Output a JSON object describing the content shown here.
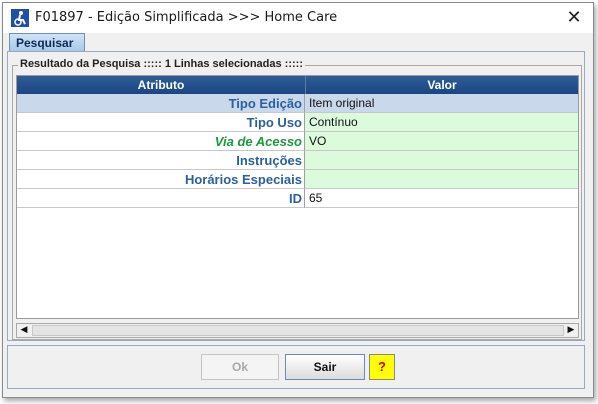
{
  "window": {
    "title": "F01897 - Edição Simplificada >>> Home Care",
    "close_glyph": "✕"
  },
  "tabs": [
    {
      "label": "Pesquisar"
    }
  ],
  "results": {
    "group_title": "Resultado da Pesquisa ::::: 1 Linhas selecionadas :::::",
    "columns": [
      "Atributo",
      "Valor"
    ],
    "rows": [
      {
        "attr": "Tipo Edição",
        "value": "Item original",
        "bg": "#c9d8ea"
      },
      {
        "attr": "Tipo Uso",
        "value": "Contínuo",
        "bg": "#dcfadc"
      },
      {
        "attr": "Via de Acesso",
        "value": "VO",
        "bg": "#dcfadc",
        "attr_color": "#1a9a3a"
      },
      {
        "attr": "Instruções",
        "value": "",
        "bg": "#dcfadc"
      },
      {
        "attr": "Horários Especiais",
        "value": "",
        "bg": "#dcfadc"
      },
      {
        "attr": "ID",
        "value": "65",
        "bg": "#ffffff"
      }
    ]
  },
  "scrollbar": {
    "left_arrow": "◀",
    "right_arrow": "▶"
  },
  "buttons": {
    "ok": "Ok",
    "sair": "Sair",
    "help": "?"
  },
  "colors": {
    "header_bg": "#1f4a86",
    "attr_text": "#2b5fa0",
    "help_bg": "#ffff00"
  }
}
